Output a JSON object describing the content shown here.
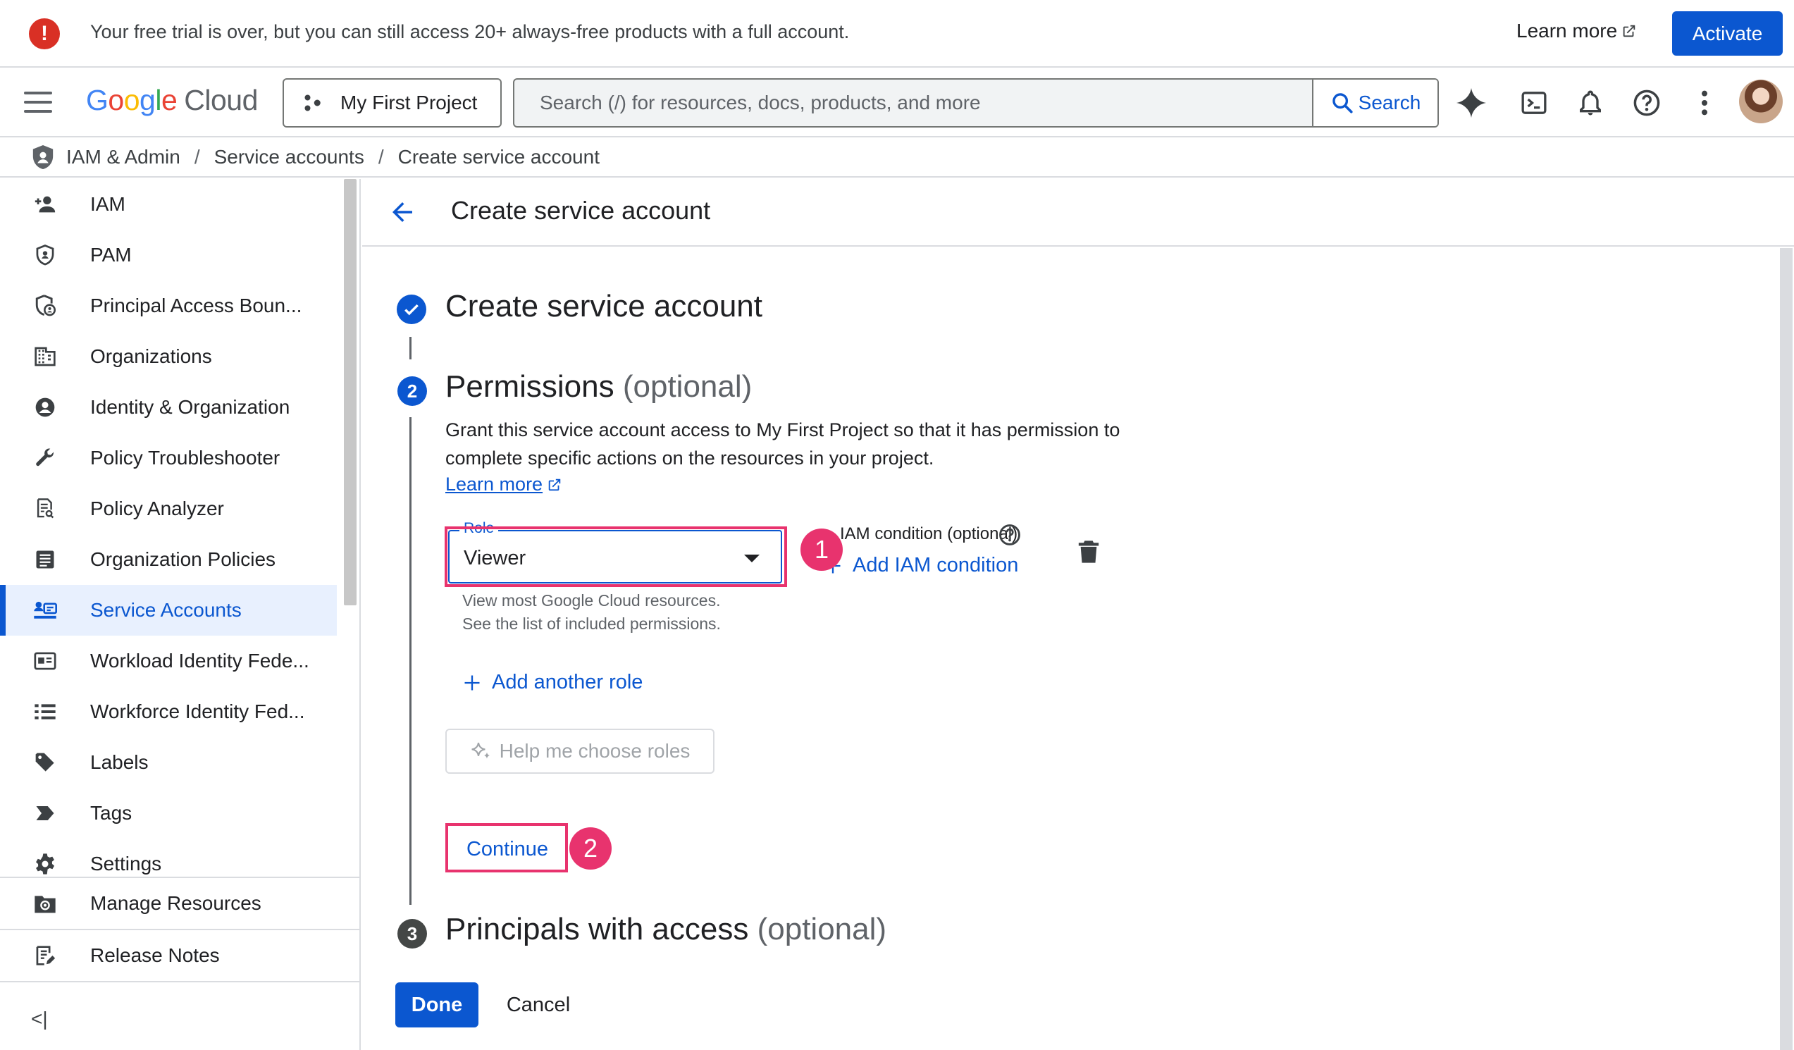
{
  "banner": {
    "message": "Your free trial is over, but you can still access 20+ always-free products with a full account.",
    "learn_more": "Learn more",
    "activate": "Activate"
  },
  "topbar": {
    "logo_letters": [
      "G",
      "o",
      "o",
      "g",
      "l",
      "e"
    ],
    "logo_cloud": "Cloud",
    "project": "My First Project",
    "search_placeholder": "Search (/) for resources, docs, products, and more",
    "search_button": "Search"
  },
  "breadcrumb": [
    "IAM & Admin",
    "Service accounts",
    "Create service account"
  ],
  "sidebar": {
    "items": [
      {
        "label": "IAM",
        "icon": "person-add-icon"
      },
      {
        "label": "PAM",
        "icon": "shield-icon"
      },
      {
        "label": "Principal Access Boun...",
        "icon": "shield-user-icon"
      },
      {
        "label": "Organizations",
        "icon": "building-icon"
      },
      {
        "label": "Identity & Organization",
        "icon": "account-circle-icon"
      },
      {
        "label": "Policy Troubleshooter",
        "icon": "wrench-icon"
      },
      {
        "label": "Policy Analyzer",
        "icon": "document-search-icon"
      },
      {
        "label": "Organization Policies",
        "icon": "article-icon"
      },
      {
        "label": "Service Accounts",
        "icon": "service-account-icon",
        "active": true
      },
      {
        "label": "Workload Identity Fede...",
        "icon": "id-card-icon"
      },
      {
        "label": "Workforce Identity Fed...",
        "icon": "list-icon"
      },
      {
        "label": "Labels",
        "icon": "tag-icon"
      },
      {
        "label": "Tags",
        "icon": "label-arrow-icon"
      },
      {
        "label": "Settings",
        "icon": "gear-icon"
      }
    ],
    "bottom_items": [
      {
        "label": "Manage Resources",
        "icon": "folder-gear-icon"
      },
      {
        "label": "Release Notes",
        "icon": "notes-icon"
      }
    ],
    "collapse_label": "<|"
  },
  "main": {
    "header_title": "Create service account",
    "steps": [
      {
        "number": "",
        "title": "Create service account",
        "optional": "",
        "status": "complete"
      },
      {
        "number": "2",
        "title": "Permissions",
        "optional": "(optional)",
        "status": "active"
      },
      {
        "number": "3",
        "title": "Principals with access",
        "optional": "(optional)",
        "status": "upcoming"
      }
    ],
    "description": "Grant this service account access to My First Project so that it has permission to complete specific actions on the resources in your project.",
    "learn_more": "Learn more",
    "role": {
      "label": "Role",
      "value": "Viewer",
      "hint_line1": "View most Google Cloud resources.",
      "hint_line2": "See the list of included permissions."
    },
    "condition_label": "IAM condition (optional)",
    "add_condition": "Add IAM condition",
    "add_role": "Add another role",
    "help_roles": "Help me choose roles",
    "continue": "Continue",
    "done": "Done",
    "cancel": "Cancel"
  },
  "annotations": [
    "1",
    "2"
  ],
  "colors": {
    "accent": "#0b57d0",
    "highlight": "#e8336e",
    "error": "#d93025"
  }
}
